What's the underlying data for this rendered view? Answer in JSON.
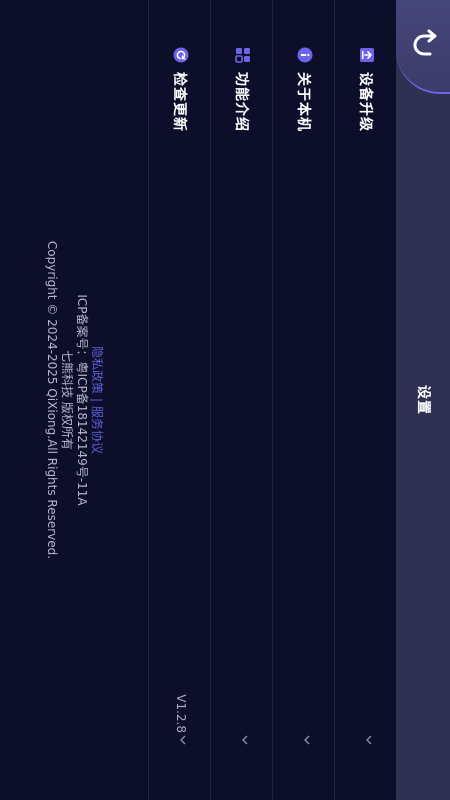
{
  "header": {
    "title": "设置"
  },
  "menu": {
    "items": [
      {
        "icon": "upgrade-icon",
        "label": "设备升级",
        "value": ""
      },
      {
        "icon": "info-icon",
        "label": "关于本机",
        "value": ""
      },
      {
        "icon": "apps-grid-icon",
        "label": "功能介绍",
        "value": ""
      },
      {
        "icon": "refresh-icon",
        "label": "检查更新",
        "value": "V1.2.8"
      }
    ]
  },
  "footer": {
    "privacy_link": "隐私政策",
    "separator": "|",
    "terms_link": "服务协议",
    "icp": "ICP备案号：粤ICP备18142149号-11A",
    "company": "七熊科技 版权所有",
    "copyright": "Copyright © 2024-2025 QiXiong.All Rights Reserved."
  },
  "colors": {
    "background": "#0d0e2a",
    "topbar": "#2f3052",
    "accent": "#5b5fd9",
    "text": "#ffffff"
  }
}
